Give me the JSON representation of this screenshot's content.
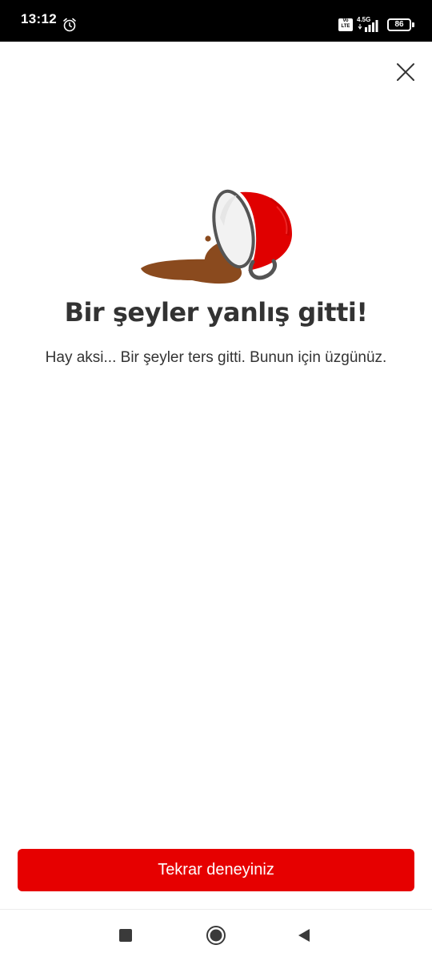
{
  "status_bar": {
    "time": "13:12",
    "alarm_icon": "alarm-clock-icon",
    "volte_label": "Vo LTE",
    "network_type": "4.5G",
    "signal_icon": "signal-bars-icon",
    "battery_level": "86"
  },
  "header": {
    "close_icon": "close-icon"
  },
  "error": {
    "illustration": "spilled-coffee-cup-illustration",
    "title": "Bir şeyler yanlış gitti!",
    "message": "Hay aksi... Bir şeyler ters gitti. Bunun için üzgünüz."
  },
  "actions": {
    "retry_label": "Tekrar deneyiniz"
  },
  "nav_bar": {
    "recents_icon": "square-recents-icon",
    "home_icon": "circle-home-icon",
    "back_icon": "triangle-back-icon"
  },
  "colors": {
    "brand_red": "#e60000",
    "cup_red": "#e00000",
    "coffee_brown": "#8a4a1e",
    "text_dark": "#333333"
  }
}
